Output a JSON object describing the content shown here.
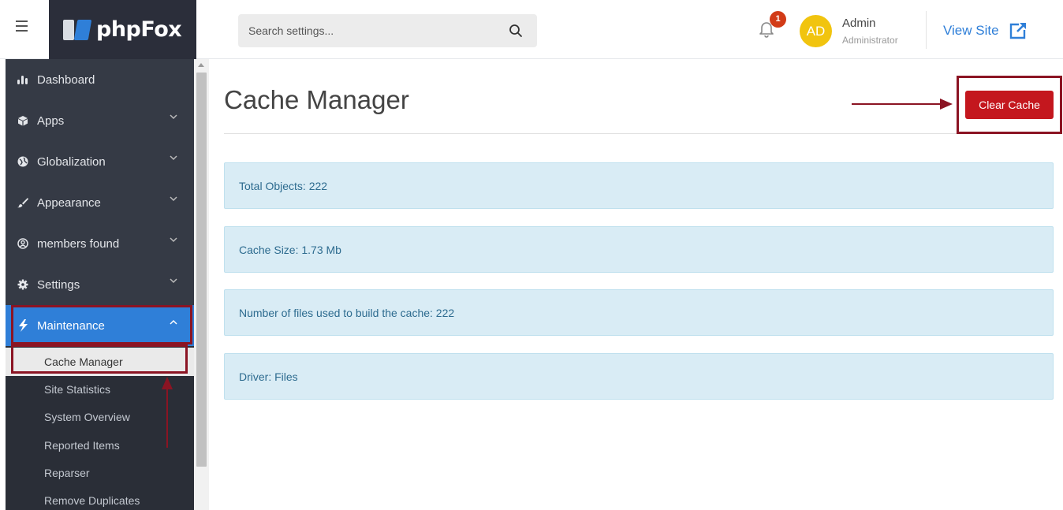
{
  "brand": {
    "logo_text": "phpFox"
  },
  "search": {
    "placeholder": "Search settings..."
  },
  "notifications": {
    "count": "1"
  },
  "user": {
    "initials": "AD",
    "name": "Admin",
    "role": "Administrator"
  },
  "header": {
    "view_site": "View Site"
  },
  "sidebar": {
    "items": [
      {
        "label": "Dashboard",
        "icon": "bar-chart-icon"
      },
      {
        "label": "Apps",
        "icon": "cube-icon"
      },
      {
        "label": "Globalization",
        "icon": "globe-icon"
      },
      {
        "label": "Appearance",
        "icon": "brush-icon"
      },
      {
        "label": "members found",
        "icon": "user-circle-icon"
      },
      {
        "label": "Settings",
        "icon": "gear-icon"
      },
      {
        "label": "Maintenance",
        "icon": "bolt-icon"
      }
    ],
    "sub_items": [
      {
        "label": "Cache Manager"
      },
      {
        "label": "Site Statistics"
      },
      {
        "label": "System Overview"
      },
      {
        "label": "Reported Items"
      },
      {
        "label": "Reparser"
      },
      {
        "label": "Remove Duplicates"
      }
    ]
  },
  "main": {
    "title": "Cache Manager",
    "clear_button": "Clear Cache",
    "info": [
      "Total Objects: 222",
      "Cache Size: 1.73 Mb",
      "Number of files used to build the cache: 222",
      "Driver: Files"
    ]
  },
  "colors": {
    "sidebar_bg": "#353a45",
    "active_blue": "#2f7fd8",
    "danger_red": "#c4171e",
    "info_bg": "#d9ecf5",
    "annotation": "#8b1423"
  }
}
